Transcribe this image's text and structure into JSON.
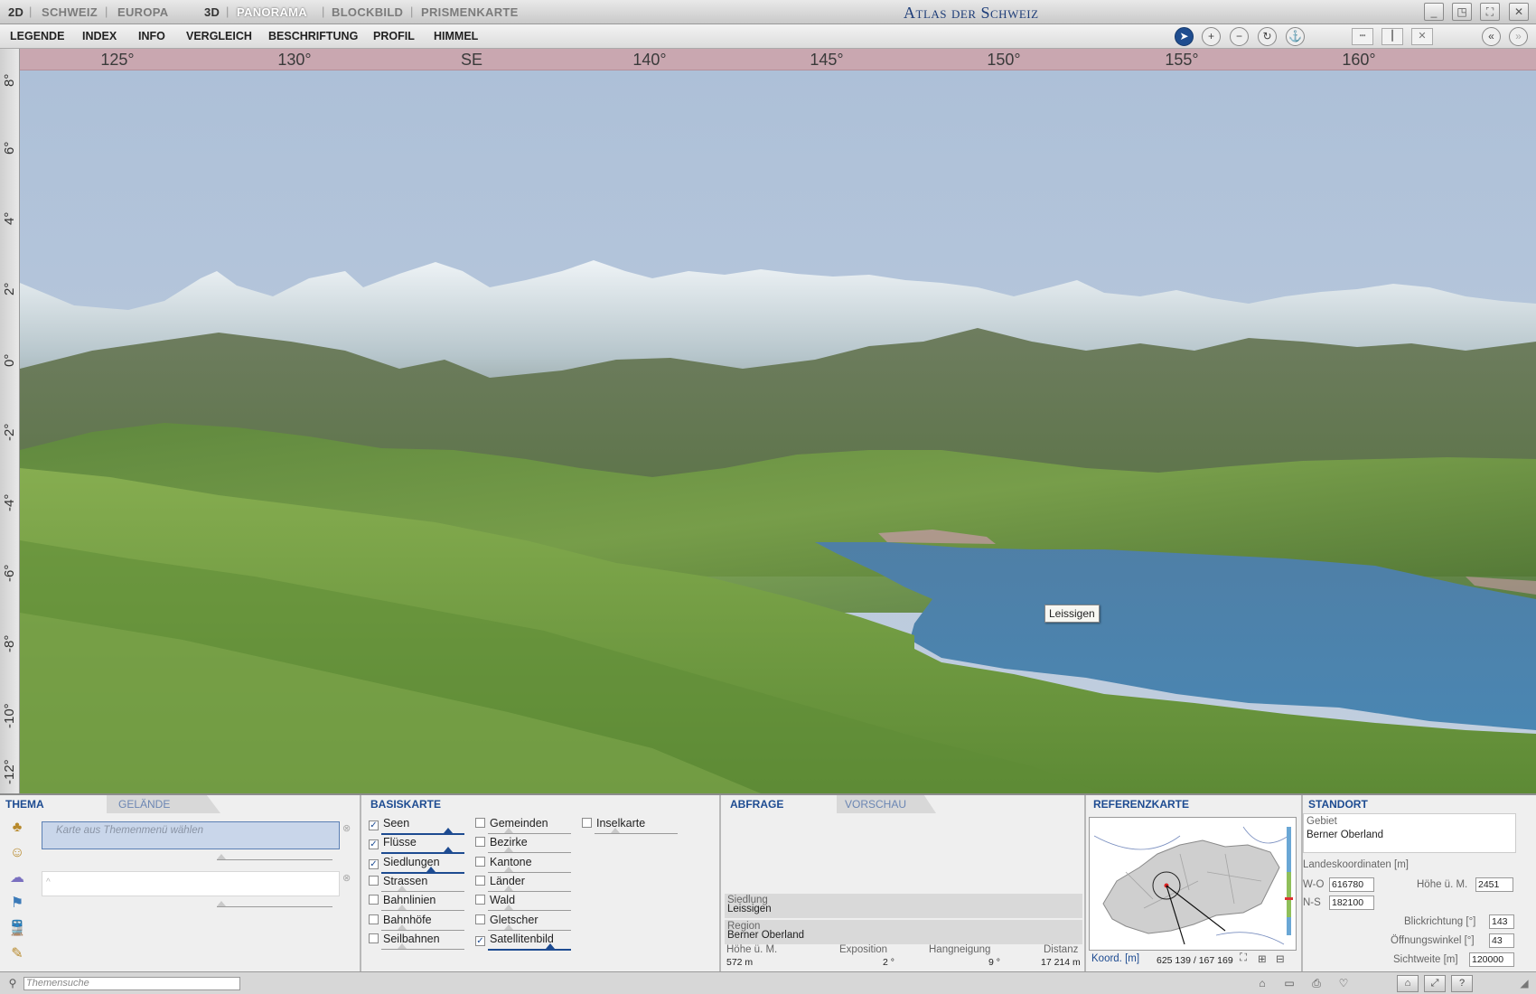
{
  "header": {
    "modes_2d": {
      "label": "2D",
      "items": [
        "SCHWEIZ",
        "EUROPA"
      ]
    },
    "modes_3d": {
      "label": "3D",
      "items": [
        "PANORAMA",
        "BLOCKBILD",
        "PRISMENKARTE"
      ]
    },
    "app_title": "Atlas der Schweiz"
  },
  "menu": [
    "LEGENDE",
    "INDEX",
    "INFO",
    "VERGLEICH",
    "BESCHRIFTUNG",
    "PROFIL",
    "HIMMEL"
  ],
  "compass": [
    "125°",
    "130°",
    "SE",
    "140°",
    "145°",
    "150°",
    "155°",
    "160°"
  ],
  "elevation": [
    "8°",
    "6°",
    "4°",
    "2°",
    "0°",
    "-2°",
    "-4°",
    "-6°",
    "-8°",
    "-10°",
    "-12°"
  ],
  "scene": {
    "tooltip": "Leissigen"
  },
  "thema": {
    "tab_active": "THEMA",
    "tab_inactive": "GELÄNDE",
    "select_placeholder": "Karte aus Themenmenü wählen",
    "icons": [
      "tree-icon",
      "people-icon",
      "cloud-icon",
      "flag-icon",
      "train-icon",
      "tools-icon"
    ]
  },
  "basiskarte": {
    "tab": "BASISKARTE",
    "col1": [
      {
        "label": "Seen",
        "checked": true,
        "opacity": 0.8
      },
      {
        "label": "Flüsse",
        "checked": true,
        "opacity": 0.8
      },
      {
        "label": "Siedlungen",
        "checked": true,
        "opacity": 0.6
      },
      {
        "label": "Strassen",
        "checked": false
      },
      {
        "label": "Bahnlinien",
        "checked": false
      },
      {
        "label": "Bahnhöfe",
        "checked": false
      },
      {
        "label": "Seilbahnen",
        "checked": false
      }
    ],
    "col2": [
      {
        "label": "Gemeinden",
        "checked": false
      },
      {
        "label": "Bezirke",
        "checked": false
      },
      {
        "label": "Kantone",
        "checked": false
      },
      {
        "label": "Länder",
        "checked": false
      },
      {
        "label": "Wald",
        "checked": false
      },
      {
        "label": "Gletscher",
        "checked": false
      },
      {
        "label": "Satellitenbild",
        "checked": true,
        "opacity": 0.75
      }
    ],
    "col3": [
      {
        "label": "Inselkarte",
        "checked": false
      }
    ]
  },
  "abfrage": {
    "tab_active": "ABFRAGE",
    "tab_inactive": "VORSCHAU",
    "siedlung_label": "Siedlung",
    "siedlung_value": "Leissigen",
    "region_label": "Region",
    "region_value": "Berner Oberland",
    "hoehe_label": "Höhe ü. M.",
    "hoehe_value": "572 m",
    "exposition_label": "Exposition",
    "exposition_value": "2 °",
    "hangneigung_label": "Hangneigung",
    "hangneigung_value": "9 °",
    "distanz_label": "Distanz",
    "distanz_value": "17 214 m"
  },
  "referenzkarte": {
    "tab": "REFERENZKARTE",
    "koord_label": "Koord. [m]",
    "koord_value": "625 139 / 167 169"
  },
  "standort": {
    "tab": "STANDORT",
    "gebiet_label": "Gebiet",
    "gebiet_value": "Berner Oberland",
    "landeskoord_label": "Landeskoordinaten [m]",
    "wo_label": "W-O",
    "wo_value": "616780",
    "ns_label": "N-S",
    "ns_value": "182100",
    "hoehe_label": "Höhe ü. M.",
    "hoehe_value": "2451",
    "blick_label": "Blickrichtung [°]",
    "blick_value": "143",
    "oeffnung_label": "Öffnungswinkel [°]",
    "oeffnung_value": "43",
    "sicht_label": "Sichtweite [m]",
    "sicht_value": "120000"
  },
  "statusbar": {
    "search_placeholder": "Themensuche"
  },
  "colors": {
    "accent": "#1d4b91",
    "title": "#1e3d78",
    "compass": "#c9a7b0",
    "lake": "#4d84ad",
    "sky": "#b2c4da"
  }
}
